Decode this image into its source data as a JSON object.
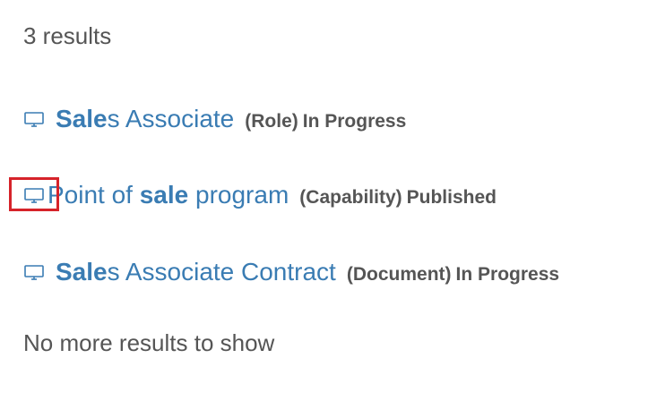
{
  "summary": {
    "count_text": "3 results"
  },
  "results": [
    {
      "icon": "monitor-icon",
      "title_bold": "Sale",
      "title_rest": "s Associate",
      "kind": "(Role)",
      "status": "In Progress"
    },
    {
      "icon": "monitor-icon",
      "title_pre": "Point of ",
      "title_bold": "sale",
      "title_post": " program",
      "kind": "(Capability)",
      "status": "Published"
    },
    {
      "icon": "monitor-icon",
      "title_bold": "Sale",
      "title_rest": "s Associate Contract",
      "kind": "(Document)",
      "status": "In Progress"
    }
  ],
  "footer": {
    "no_more_text": "No more results to show"
  },
  "colors": {
    "link": "#3a7cb3",
    "text": "#555555",
    "highlight": "#d6232a"
  }
}
